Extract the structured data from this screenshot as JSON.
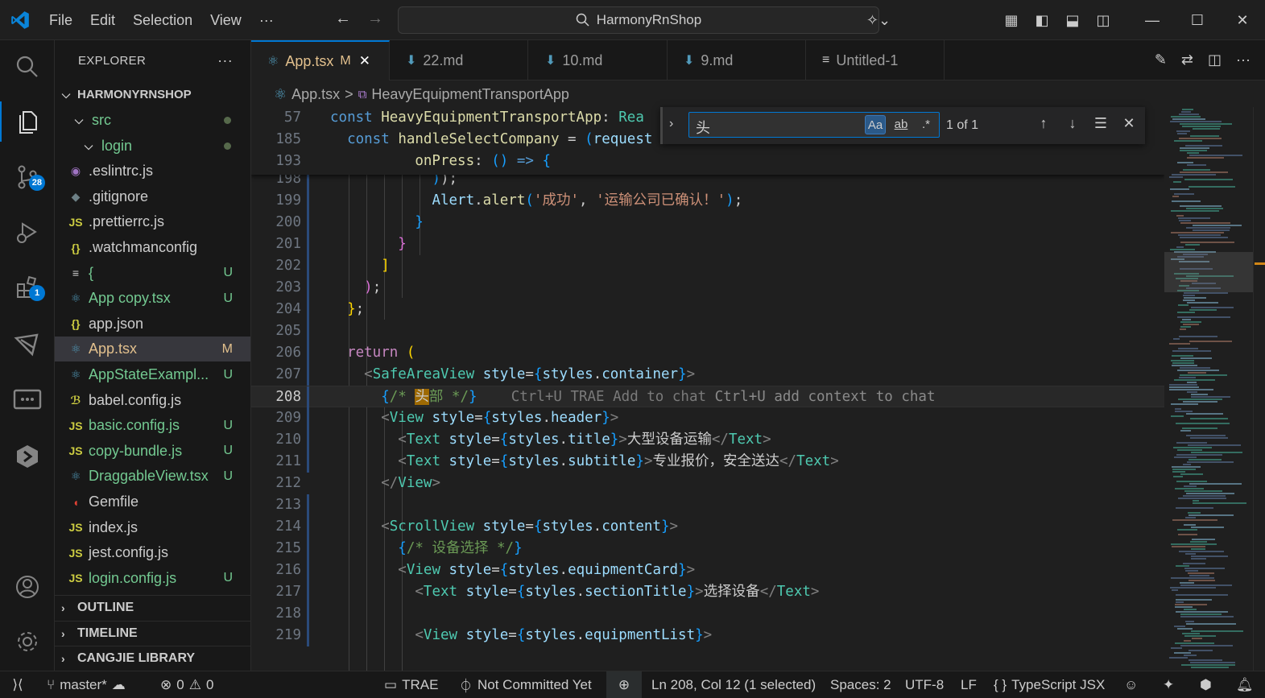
{
  "menu": [
    "File",
    "Edit",
    "Selection",
    "View",
    "···"
  ],
  "command_center": "HarmonyRnShop",
  "activity_badges": {
    "scm": "28",
    "extensions": "1"
  },
  "explorer": {
    "title": "EXPLORER",
    "more": "···",
    "root": "HARMONYRNSHOP",
    "items": [
      {
        "name": "src",
        "icon": "chevron-down",
        "color": "#73c991",
        "indent": 18,
        "dot": true
      },
      {
        "name": "login",
        "icon": "chevron-down",
        "color": "#73c991",
        "indent": 30,
        "dot": true
      },
      {
        "name": ".eslintrc.js",
        "icon": "◉",
        "icon_color": "#a074c4",
        "color": "#cccccc",
        "indent": 14
      },
      {
        "name": ".gitignore",
        "icon": "◆",
        "icon_color": "#6d8086",
        "color": "#cccccc",
        "indent": 14
      },
      {
        "name": ".prettierrc.js",
        "icon": "JS",
        "icon_color": "#cbcb41",
        "color": "#cccccc",
        "indent": 14
      },
      {
        "name": ".watchmanconfig",
        "icon": "{}",
        "icon_color": "#cbcb41",
        "color": "#cccccc",
        "indent": 14
      },
      {
        "name": "{",
        "icon": "≡",
        "icon_color": "#cccccc",
        "color": "#73c991",
        "indent": 14,
        "status": "U"
      },
      {
        "name": "App copy.tsx",
        "icon": "⚛",
        "icon_color": "#519aba",
        "color": "#73c991",
        "indent": 14,
        "status": "U"
      },
      {
        "name": "app.json",
        "icon": "{}",
        "icon_color": "#cbcb41",
        "color": "#cccccc",
        "indent": 14
      },
      {
        "name": "App.tsx",
        "icon": "⚛",
        "icon_color": "#519aba",
        "color": "#e2c08d",
        "indent": 14,
        "status": "M",
        "selected": true
      },
      {
        "name": "AppStateExampl...",
        "icon": "⚛",
        "icon_color": "#519aba",
        "color": "#73c991",
        "indent": 14,
        "status": "U"
      },
      {
        "name": "babel.config.js",
        "icon": "ℬ",
        "icon_color": "#cbcb41",
        "color": "#cccccc",
        "indent": 14
      },
      {
        "name": "basic.config.js",
        "icon": "JS",
        "icon_color": "#cbcb41",
        "color": "#73c991",
        "indent": 14,
        "status": "U"
      },
      {
        "name": "copy-bundle.js",
        "icon": "JS",
        "icon_color": "#cbcb41",
        "color": "#73c991",
        "indent": 14,
        "status": "U"
      },
      {
        "name": "DraggableView.tsx",
        "icon": "⚛",
        "icon_color": "#519aba",
        "color": "#73c991",
        "indent": 14,
        "status": "U"
      },
      {
        "name": "Gemfile",
        "icon": "◖",
        "icon_color": "#e34234",
        "color": "#cccccc",
        "indent": 14
      },
      {
        "name": "index.js",
        "icon": "JS",
        "icon_color": "#cbcb41",
        "color": "#cccccc",
        "indent": 14
      },
      {
        "name": "jest.config.js",
        "icon": "JS",
        "icon_color": "#cbcb41",
        "color": "#cccccc",
        "indent": 14
      },
      {
        "name": "login.config.js",
        "icon": "JS",
        "icon_color": "#cbcb41",
        "color": "#73c991",
        "indent": 14,
        "status": "U"
      }
    ],
    "sections": [
      "OUTLINE",
      "TIMELINE",
      "CANGJIE LIBRARY"
    ]
  },
  "tabs": [
    {
      "label": "App.tsx",
      "status": "M",
      "icon": "⚛",
      "icon_color": "#519aba",
      "active": true,
      "close": "✕"
    },
    {
      "label": "22.md",
      "icon": "⬇",
      "icon_color": "#519aba"
    },
    {
      "label": "10.md",
      "icon": "⬇",
      "icon_color": "#519aba"
    },
    {
      "label": "9.md",
      "icon": "⬇",
      "icon_color": "#519aba"
    },
    {
      "label": "Untitled-1",
      "icon": "≡",
      "icon_color": "#cccccc"
    }
  ],
  "breadcrumb": {
    "file": "App.tsx",
    "separator": ">",
    "symbol": "HeavyEquipmentTransportApp"
  },
  "find": {
    "query": "头",
    "case_label": "Aa",
    "word_label": "ab",
    "regex_label": ".*",
    "count": "1 of 1"
  },
  "status": {
    "branch": "master*",
    "errors": "0",
    "warnings": "0",
    "trae": "TRAE",
    "commit": "Not Committed Yet",
    "position": "Ln 208, Col 12 (1 selected)",
    "spaces": "Spaces: 2",
    "encoding": "UTF-8",
    "eol": "LF",
    "language": "TypeScript JSX"
  }
}
